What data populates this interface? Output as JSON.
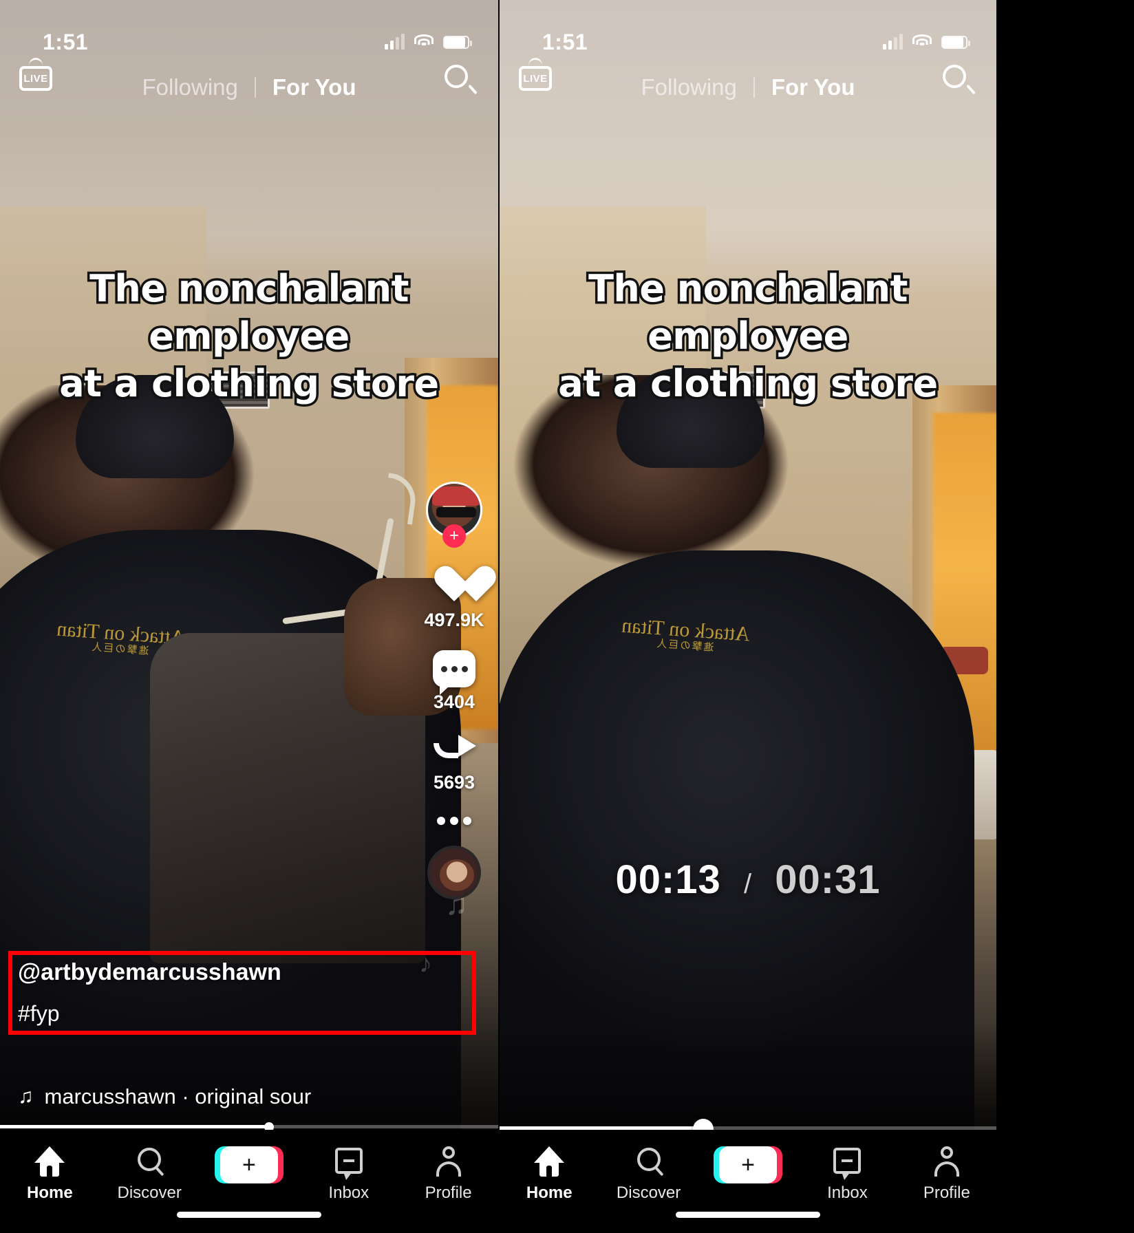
{
  "screen": {
    "app": "TikTok",
    "annotation_color": "#ff0000"
  },
  "status_bar": {
    "time": "1:51",
    "signal_icon": "cellular-signal-icon",
    "wifi_icon": "wifi-icon",
    "battery_icon": "battery-icon"
  },
  "top_nav": {
    "live_label": "LIVE",
    "tabs": [
      {
        "label": "Following",
        "active": false
      },
      {
        "label": "For You",
        "active": true
      }
    ],
    "search_icon": "search-icon"
  },
  "video": {
    "caption_line1": "The nonchalant employee",
    "caption_line2": "at a clothing store",
    "handle": "@artbydemarcusshawn",
    "hashtag": "#fyp",
    "music_text": "marcusshawn · original sour",
    "music_icon": "music-note-icon",
    "hoodie_logo": "Attack on Titan",
    "hoodie_logo_sub": "進撃の巨人"
  },
  "actions": {
    "avatar_name": "creator-avatar",
    "follow_label": "+",
    "like_count": "497.9K",
    "comment_count": "3404",
    "share_count": "5693",
    "more_icon": "more-horizontal-icon",
    "sound_disc": "sound-disc-icon"
  },
  "playback": {
    "current_time": "00:13",
    "separator": "/",
    "total_time": "00:31",
    "left_progress_percent": 54,
    "right_progress_percent": 41
  },
  "bottom_nav": {
    "items": [
      {
        "label": "Home",
        "icon": "home-icon",
        "active": true
      },
      {
        "label": "Discover",
        "icon": "search-icon",
        "active": false
      },
      {
        "label": "",
        "icon": "create-plus-icon",
        "active": false
      },
      {
        "label": "Inbox",
        "icon": "inbox-icon",
        "active": false
      },
      {
        "label": "Profile",
        "icon": "person-icon",
        "active": false
      }
    ],
    "create_label": "+"
  }
}
